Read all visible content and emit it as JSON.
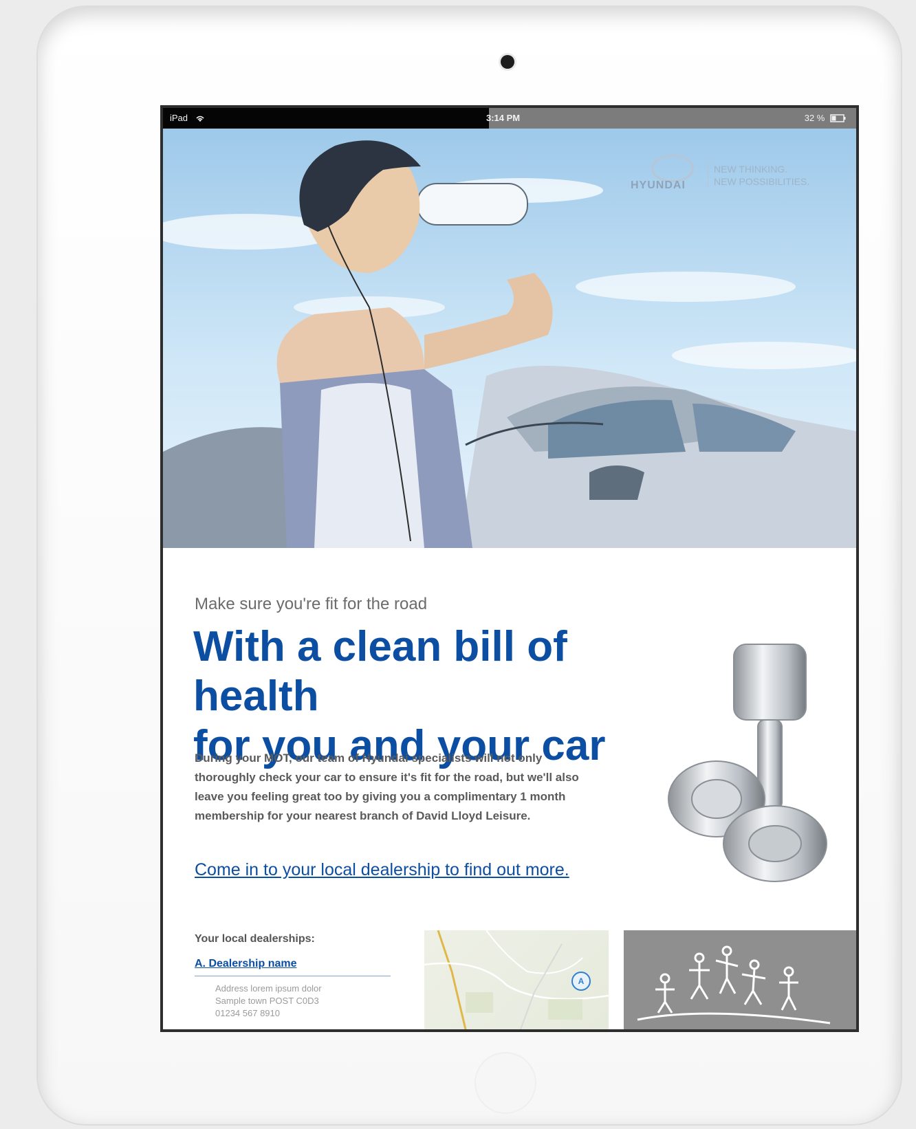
{
  "status_bar": {
    "device": "iPad",
    "time": "3:14 PM",
    "battery": "32 %"
  },
  "brand": {
    "wordmark": "HYUNDAI",
    "tagline_1": "NEW THINKING.",
    "tagline_2": "NEW POSSIBILITIES."
  },
  "content": {
    "kicker": "Make sure you're fit for the road",
    "headline_line1": "With a clean bill of health",
    "headline_line2": "for you and your car",
    "body": "During your MOT, our team of Hyundai specialists will not only thoroughly check your car to ensure it's fit for the road, but we'll also leave you feeling great too by giving you a complimentary 1 month membership for your nearest branch of David Lloyd Leisure.",
    "cta": "Come in to your local dealership to find out more."
  },
  "dealerships": {
    "title": "Your local dealerships:",
    "name": "A.  Dealership name",
    "address_line1": "Address lorem ipsum dolor",
    "address_line2": "Sample town POST C0D3",
    "phone": "01234 567 8910",
    "map_marker": "A"
  },
  "colors": {
    "brand_blue": "#0b4ea2",
    "body_gray": "#5a5a5a"
  },
  "icons": {
    "wifi": "wifi-icon",
    "battery": "battery-icon",
    "camera": "camera-icon",
    "home": "home-button-icon"
  }
}
